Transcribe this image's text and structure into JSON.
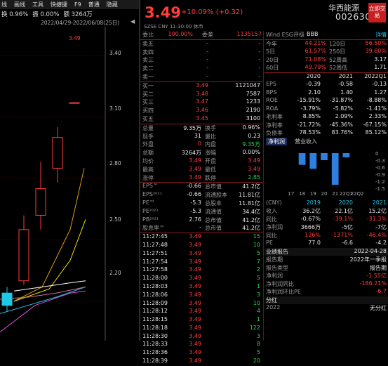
{
  "menu": [
    "线",
    "画线",
    "工具",
    "快捷键",
    "F9",
    "普通",
    "隐藏"
  ],
  "info": {
    "turnover": "换 0.96%",
    "amplitude": "振 0.00%",
    "amount": "额 3264万"
  },
  "date_range": "2022/04/29-2022/06/08(25日)",
  "price_labels": {
    "p1": "3.49",
    "p2": "3.40",
    "p3": "3.10",
    "p4": "2.80",
    "p5": "2.50",
    "p6": "2.20"
  },
  "header": {
    "price": "3.49",
    "change": "+10.09% (+0.32)",
    "name": "华西能源",
    "code": "002630",
    "trade_button": "立即交易",
    "market": "SZSE  CNY  11:30:00  休市"
  },
  "orderbook": {
    "ratio": {
      "label": "委比",
      "val1": "100.00%",
      "label2": "委差",
      "val2": "1135157"
    },
    "asks": [
      {
        "l": "卖五",
        "p": "-",
        "v": "-"
      },
      {
        "l": "卖四",
        "p": "-",
        "v": "-"
      },
      {
        "l": "卖三",
        "p": "-",
        "v": "-"
      },
      {
        "l": "卖二",
        "p": "-",
        "v": "-"
      },
      {
        "l": "卖一",
        "p": "-",
        "v": "-"
      }
    ],
    "bids": [
      {
        "l": "买一",
        "p": "3.49",
        "v": "1121047"
      },
      {
        "l": "买二",
        "p": "3.48",
        "v": "7587"
      },
      {
        "l": "买三",
        "p": "3.47",
        "v": "1233"
      },
      {
        "l": "买四",
        "p": "3.46",
        "v": "2190"
      },
      {
        "l": "买五",
        "p": "3.45",
        "v": "3100"
      }
    ],
    "stats": [
      {
        "a": "总量",
        "b": "9.35万",
        "c": "换手",
        "d": "0.96%"
      },
      {
        "a": "现手",
        "b": "31",
        "c": "量比",
        "d": "0.23"
      },
      {
        "a": "外盘",
        "b": "0",
        "c": "内盘",
        "d": "9.35万"
      },
      {
        "a": "总额",
        "b": "3264万",
        "c": "涨幅",
        "d": "0.00%"
      },
      {
        "a": "均价",
        "b": "3.49",
        "c": "开盘",
        "d": "3.49"
      },
      {
        "a": "最高",
        "b": "3.49",
        "c": "最低",
        "d": "3.49"
      },
      {
        "a": "涨停",
        "b": "3.49",
        "c": "跌停",
        "d": "2.85"
      }
    ],
    "fund": [
      {
        "a": "EPS™",
        "b": "-0.66",
        "c": "总市值",
        "d": "41.2亿"
      },
      {
        "a": "EPS²⁰²¹",
        "b": "-0.66",
        "c": "流通股本",
        "d": "11.81亿"
      },
      {
        "a": "PE™",
        "b": "-5.3",
        "c": "总股本",
        "d": "11.81亿"
      },
      {
        "a": "PE²⁰²¹",
        "b": "-5.3",
        "c": "流通值",
        "d": "34.4亿"
      },
      {
        "a": "PB²⁰²¹",
        "b": "2.76",
        "c": "总市值",
        "d": "41.2亿"
      },
      {
        "a": "股息率™",
        "b": "-",
        "c": "总市值",
        "d": "41.2亿"
      }
    ],
    "ticks": [
      {
        "t": "11:27:45",
        "p": "3.49",
        "v": "15"
      },
      {
        "t": "11:27:48",
        "p": "3.49",
        "v": "10"
      },
      {
        "t": "11:27:51",
        "p": "3.49",
        "v": "5"
      },
      {
        "t": "11:27:54",
        "p": "3.49",
        "v": "7"
      },
      {
        "t": "11:27:58",
        "p": "3.49",
        "v": "2"
      },
      {
        "t": "11:28:00",
        "p": "3.49",
        "v": "5"
      },
      {
        "t": "11:28:03",
        "p": "3.49",
        "v": "1"
      },
      {
        "t": "11:28:06",
        "p": "3.49",
        "v": "3"
      },
      {
        "t": "11:28:09",
        "p": "3.49",
        "v": "10"
      },
      {
        "t": "11:28:12",
        "p": "3.49",
        "v": "4"
      },
      {
        "t": "11:28:15",
        "p": "3.49",
        "v": "1"
      },
      {
        "t": "11:28:18",
        "p": "3.49",
        "v": "122"
      },
      {
        "t": "11:28:30",
        "p": "3.49",
        "v": "3"
      },
      {
        "t": "11:28:33",
        "p": "3.49",
        "v": "8"
      },
      {
        "t": "11:28:36",
        "p": "3.49",
        "v": "5"
      },
      {
        "t": "11:28:39",
        "p": "3.49",
        "v": "20"
      }
    ]
  },
  "rightpanel": {
    "esg": {
      "label": "Wind ESG评级",
      "grade": "BBB",
      "detail": "详情"
    },
    "perf": [
      {
        "a": "今年",
        "b": "44.21%",
        "c": "120日",
        "d": "56.50%"
      },
      {
        "a": "5日",
        "b": "61.57%",
        "c": "250日",
        "d": "39.60%"
      },
      {
        "a": "20日",
        "b": "71.08%",
        "c": "52周高",
        "d": "3.17"
      },
      {
        "a": "60日",
        "b": "49.79%",
        "c": "52周低",
        "d": "1.71"
      }
    ],
    "fin_header": [
      "2020",
      "2021",
      "2022Q1"
    ],
    "fin": [
      {
        "k": "EPS",
        "v": [
          "-0.39",
          "-0.58",
          "-0.13"
        ]
      },
      {
        "k": "BPS",
        "v": [
          "2.10",
          "1.40",
          "1.27"
        ]
      },
      {
        "k": "ROE",
        "v": [
          "-15.91%",
          "-31.87%",
          "-8.88%"
        ]
      },
      {
        "k": "ROA",
        "v": [
          "-3.79%",
          "-5.82%",
          "-1.41%"
        ]
      },
      {
        "k": "毛利率",
        "v": [
          "8.85%",
          "2.09%",
          "2.33%"
        ]
      },
      {
        "k": "净利率",
        "v": [
          "-21.72%",
          "-45.36%",
          "-67.15%"
        ]
      },
      {
        "k": "负债率",
        "v": [
          "78.53%",
          "83.76%",
          "85.12%"
        ]
      }
    ],
    "tabs": [
      "净利润",
      "营业收入"
    ],
    "bar_chart": {
      "categories": [
        "17",
        "18",
        "19",
        "20",
        "21",
        "22Q1",
        "22Q2"
      ],
      "values": [
        0,
        -0.5,
        -0.67,
        -0.3,
        -1.35,
        -0.18,
        0
      ],
      "ylabels": [
        "0",
        "-0.3",
        "-0.6",
        "-0.9",
        "-1.2",
        "-1.5"
      ]
    },
    "annual_header": {
      "unit": "(CNY)",
      "y1": "2019",
      "y2": "2020",
      "y3": "2021"
    },
    "annual": [
      {
        "k": "收入",
        "v": [
          "36.2亿",
          "22.1亿",
          "15.2亿"
        ]
      },
      {
        "k": "同比",
        "v": [
          "-0.67%",
          "-39.1%",
          "-31.3%"
        ]
      },
      {
        "k": "净利润",
        "v": [
          "3666万",
          "-5亿",
          "-7亿"
        ]
      },
      {
        "k": "同比",
        "v": [
          "126%",
          "-1371%",
          "-46.4%"
        ]
      },
      {
        "k": "PE",
        "v": [
          "77.0",
          "-6.6",
          "-4.2"
        ]
      }
    ],
    "report": {
      "title": "业绩报告",
      "date": "2022-04-28",
      "rows": [
        {
          "a": "报告期",
          "b": "2022年一季报"
        },
        {
          "a": "报告类型",
          "b": "报告期"
        },
        {
          "a": "净利润",
          "b": "-1.55亿"
        },
        {
          "a": "净利润同比",
          "b": "-186.21%"
        },
        {
          "a": "净利润环比PE",
          "b": "-6.7"
        }
      ]
    },
    "dividend": {
      "title": "分红",
      "year": "2022",
      "val": "无分红"
    }
  },
  "chart_data": {
    "type": "candlestick",
    "ylim": [
      2.1,
      3.5
    ],
    "candles": [
      {
        "o": 2.18,
        "c": 2.24,
        "h": 2.27,
        "l": 2.15,
        "up": false
      },
      {
        "o": 2.3,
        "c": 2.55,
        "h": 2.62,
        "l": 2.28,
        "up": true
      },
      {
        "o": 2.62,
        "c": 2.75,
        "h": 2.88,
        "l": 2.55,
        "up": true
      },
      {
        "o": 2.85,
        "c": 3.0,
        "h": 3.05,
        "l": 2.78,
        "up": true
      },
      {
        "o": 3.17,
        "c": 3.17,
        "h": 3.17,
        "l": 3.17,
        "up": true
      }
    ],
    "lines": [
      {
        "color": "#e0a000",
        "pts": [
          [
            20,
            2.2
          ],
          [
            60,
            2.27
          ],
          [
            100,
            2.55
          ],
          [
            120,
            2.85
          ]
        ]
      },
      {
        "color": "#f0e000",
        "pts": [
          [
            20,
            2.2
          ],
          [
            70,
            2.26
          ],
          [
            100,
            2.4
          ],
          [
            122,
            2.6
          ]
        ]
      },
      {
        "color": "#ffffff",
        "pts": [
          [
            20,
            2.25
          ],
          [
            60,
            2.27
          ],
          [
            100,
            2.29
          ],
          [
            122,
            2.3
          ]
        ]
      },
      {
        "color": "#e050e0",
        "pts": [
          [
            0,
            2.05
          ],
          [
            50,
            2.18
          ],
          [
            100,
            2.24
          ],
          [
            122,
            2.25
          ]
        ]
      },
      {
        "color": "#1ec8e6",
        "pts": [
          [
            0,
            2.14
          ],
          [
            40,
            2.18
          ],
          [
            80,
            2.22
          ],
          [
            122,
            2.27
          ]
        ]
      },
      {
        "color": "#d070a0",
        "pts": [
          [
            0,
            2.21
          ],
          [
            40,
            2.22
          ],
          [
            80,
            2.24
          ],
          [
            122,
            2.27
          ]
        ]
      }
    ]
  }
}
